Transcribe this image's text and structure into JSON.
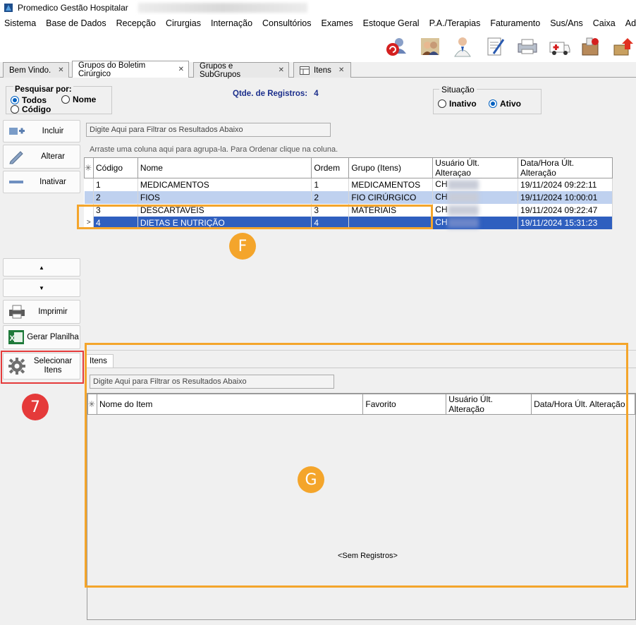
{
  "app": {
    "title": "Promedico Gestão Hospitalar"
  },
  "menu": [
    "Sistema",
    "Base de Dados",
    "Recepção",
    "Cirurgias",
    "Internação",
    "Consultórios",
    "Exames",
    "Estoque Geral",
    "P.A./Terapias",
    "Faturamento",
    "Sus/Ans",
    "Caixa",
    "Administração"
  ],
  "toolbar_icons": [
    "refresh-user-icon",
    "group-icon",
    "doctor-icon",
    "document-pen-icon",
    "printer-icon",
    "ambulance-icon",
    "medicine-box-icon",
    "upload-box-icon"
  ],
  "tabs": [
    {
      "label": "Bem Vindo."
    },
    {
      "label": "Grupos do Boletim Cirúrgico"
    },
    {
      "label": "Grupos e SubGrupos"
    },
    {
      "label": "Itens"
    }
  ],
  "search": {
    "legend": "Pesquisar por:",
    "options": [
      "Todos",
      "Nome",
      "Código"
    ],
    "selected": "Todos"
  },
  "records": {
    "label": "Qtde. de Registros:",
    "count": "4"
  },
  "situacao": {
    "legend": "Situação",
    "options": [
      "Inativo",
      "Ativo"
    ],
    "selected": "Ativo"
  },
  "side_buttons": {
    "incluir": "Incluir",
    "alterar": "Alterar",
    "inativar": "Inativar",
    "up": "▲",
    "down": "▼",
    "imprimir": "Imprimir",
    "gerar_planilha": "Gerar Planilha",
    "selecionar_itens_1": "Selecionar",
    "selecionar_itens_2": "Itens"
  },
  "filter_placeholder": "Digite Aqui para Filtrar os Resultados Abaixo",
  "group_hint": "Arraste uma coluna aqui para agrupa-la. Para Ordenar clique na coluna.",
  "grid1": {
    "columns": [
      "Código",
      "Nome",
      "Ordem",
      "Grupo (Itens)",
      "Usuário Últ. Alteraçao",
      "Data/Hora Últ. Alteração"
    ],
    "rows": [
      [
        "1",
        "MEDICAMENTOS",
        "1",
        "MEDICAMENTOS",
        "CH",
        "19/11/2024 09:22:11"
      ],
      [
        "2",
        "FIOS",
        "2",
        "FIO CIRÚRGICO",
        "CH",
        "19/11/2024 10:00:01"
      ],
      [
        "3",
        "DESCARTAVEIS",
        "3",
        "MATERIAIS",
        "CH",
        "19/11/2024 09:22:47"
      ],
      [
        "4",
        "DIETAS E NUTRIÇÃO",
        "4",
        "",
        "CH",
        "19/11/2024 15:31:23"
      ]
    ]
  },
  "bottom": {
    "tab": "Itens",
    "columns": [
      "Nome do Item",
      "Favorito",
      "Usuário Últ. Alteração",
      "Data/Hora Últ. Alteração"
    ],
    "empty": "<Sem Registros>"
  },
  "annotations": {
    "f": "F",
    "g": "G",
    "seven": "7"
  },
  "colors": {
    "orange": "#f4a52b",
    "red": "#e53a3a",
    "selected_row": "#2f5fbf",
    "alt_row": "#bfd1ef"
  }
}
